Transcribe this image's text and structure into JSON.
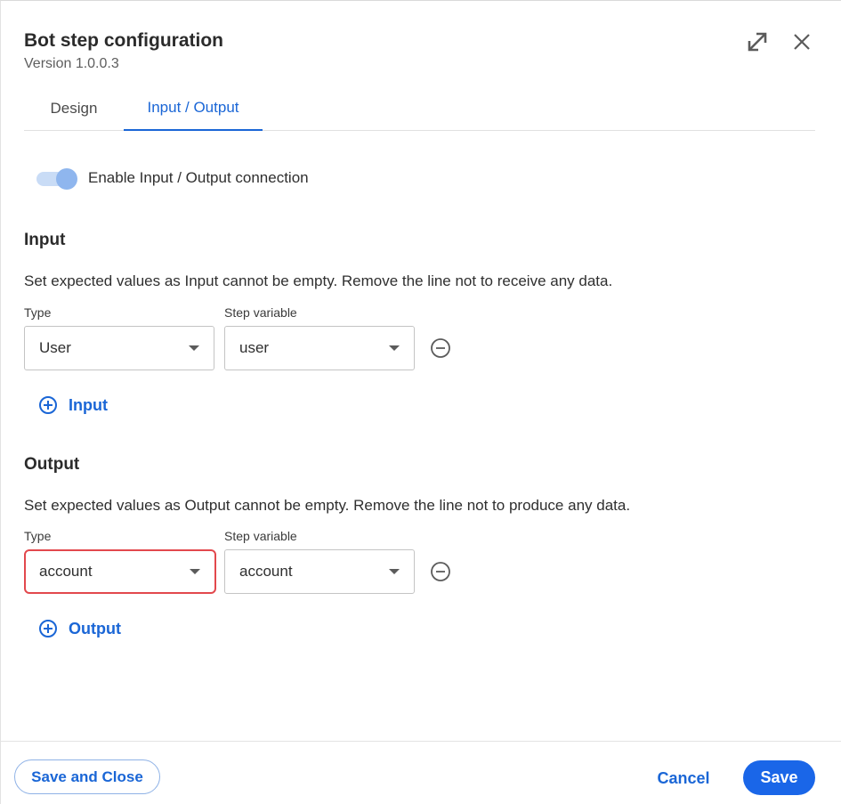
{
  "dialog": {
    "title": "Bot step configuration",
    "version": "Version 1.0.0.3"
  },
  "header_icons": [
    "expand-icon",
    "close-icon"
  ],
  "tabs": [
    {
      "label": "Design",
      "active": false
    },
    {
      "label": "Input / Output",
      "active": true
    }
  ],
  "toggle": {
    "label": "Enable Input / Output connection",
    "enabled": true
  },
  "input_section": {
    "title": "Input",
    "description": "Set expected values as Input cannot be empty. Remove the line not to receive any data.",
    "type_label": "Type",
    "variable_label": "Step variable",
    "rows": [
      {
        "type": "User",
        "variable": "user"
      }
    ],
    "add_label": "Input"
  },
  "output_section": {
    "title": "Output",
    "description": "Set expected values as Output cannot be empty. Remove the line not to produce any data.",
    "type_label": "Type",
    "variable_label": "Step variable",
    "rows": [
      {
        "type": "account",
        "variable": "account"
      }
    ],
    "add_label": "Output"
  },
  "footer": {
    "save_close_label": "Save and Close",
    "cancel_label": "Cancel",
    "save_label": "Save"
  },
  "colors": {
    "accent": "#1a66d6",
    "primary_button": "#1a66e8",
    "highlight_border": "#e2484d"
  }
}
